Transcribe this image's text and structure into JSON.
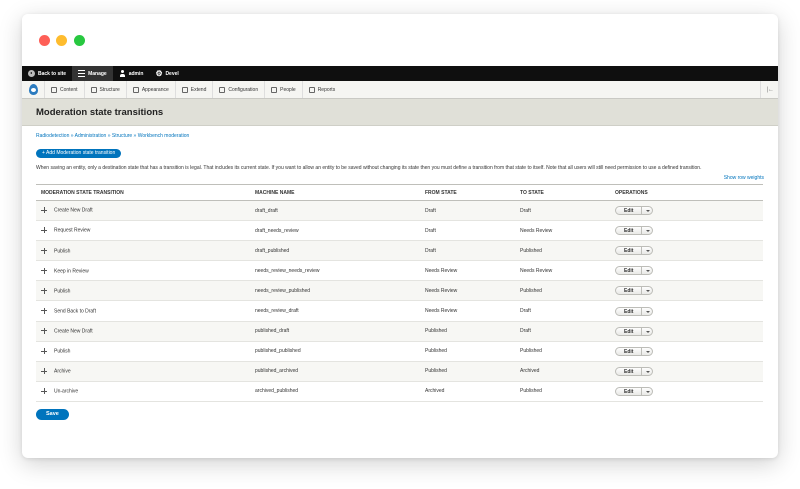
{
  "window": {
    "buttons": [
      "close",
      "minimize",
      "zoom"
    ]
  },
  "toolbar": {
    "back_label": "Back to site",
    "manage_label": "Manage",
    "user_label": "admin",
    "devel_label": "Devel"
  },
  "adminbar": {
    "items": [
      {
        "label": "Content",
        "icon": "content-icon"
      },
      {
        "label": "Structure",
        "icon": "structure-icon"
      },
      {
        "label": "Appearance",
        "icon": "appearance-icon"
      },
      {
        "label": "Extend",
        "icon": "extend-icon"
      },
      {
        "label": "Configuration",
        "icon": "wrench-icon"
      },
      {
        "label": "People",
        "icon": "people-icon"
      },
      {
        "label": "Reports",
        "icon": "reports-icon"
      }
    ],
    "collapse_label": "|←"
  },
  "page": {
    "title": "Moderation state transitions",
    "breadcrumb": "Radiodetection » Administration » Structure » Workbench moderation",
    "add_button": "+ Add Moderation state transition",
    "description": "When saving an entity, only a destination state that has a transition is legal. That includes its current state. If you want to allow an entity to be saved without changing its state then you must define a transition from that state to itself. Note that all users will still need permission to use a defined transition.",
    "row_weights_link": "Show row weights",
    "save_button": "Save"
  },
  "table": {
    "headers": [
      "MODERATION STATE TRANSITION",
      "MACHINE NAME",
      "FROM STATE",
      "TO STATE",
      "OPERATIONS"
    ],
    "edit_label": "Edit",
    "rows": [
      {
        "name": "Create New Draft",
        "machine": "draft_draft",
        "from": "Draft",
        "to": "Draft"
      },
      {
        "name": "Request Review",
        "machine": "draft_needs_review",
        "from": "Draft",
        "to": "Needs Review"
      },
      {
        "name": "Publish",
        "machine": "draft_published",
        "from": "Draft",
        "to": "Published"
      },
      {
        "name": "Keep in Review",
        "machine": "needs_review_needs_review",
        "from": "Needs Review",
        "to": "Needs Review"
      },
      {
        "name": "Publish",
        "machine": "needs_review_published",
        "from": "Needs Review",
        "to": "Published"
      },
      {
        "name": "Send Back to Draft",
        "machine": "needs_review_draft",
        "from": "Needs Review",
        "to": "Draft"
      },
      {
        "name": "Create New Draft",
        "machine": "published_draft",
        "from": "Published",
        "to": "Draft"
      },
      {
        "name": "Publish",
        "machine": "published_published",
        "from": "Published",
        "to": "Published"
      },
      {
        "name": "Archive",
        "machine": "published_archived",
        "from": "Published",
        "to": "Archived"
      },
      {
        "name": "Un-archive",
        "machine": "archived_published",
        "from": "Archived",
        "to": "Published"
      }
    ]
  },
  "colors": {
    "accent": "#0074bd",
    "toolbar": "#0f0f0f",
    "header": "#e0e0d8"
  }
}
